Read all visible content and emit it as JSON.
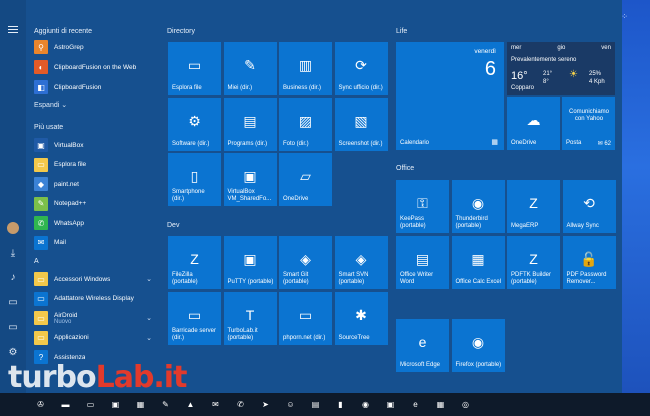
{
  "rail": {
    "hamburger": "menu-icon"
  },
  "recent": {
    "header": "Aggiunti di recente",
    "items": [
      {
        "label": "AstroGrep",
        "color": "#e9852c",
        "icon": "⚲"
      },
      {
        "label": "ClipboardFusion on the Web",
        "color": "#e25b28",
        "icon": "◐"
      },
      {
        "label": "ClipboardFusion",
        "color": "#2d6fd4",
        "icon": "◧"
      }
    ],
    "expand": "Espandi ⌄"
  },
  "most_used": {
    "header": "Più usate",
    "items": [
      {
        "label": "VirtualBox",
        "color": "#1f5aa6",
        "icon": "▣"
      },
      {
        "label": "Esplora file",
        "color": "#f2c84b",
        "icon": "▭"
      },
      {
        "label": "paint.net",
        "color": "#3b82d6",
        "icon": "◆"
      },
      {
        "label": "Notepad++",
        "color": "#7bbf4a",
        "icon": "✎"
      },
      {
        "label": "WhatsApp",
        "color": "#2fb650",
        "icon": "✆"
      },
      {
        "label": "Mail",
        "color": "#0b74d1",
        "icon": "✉"
      }
    ]
  },
  "alpha": {
    "header": "A",
    "items": [
      {
        "label": "Accessori Windows",
        "sub": "",
        "color": "#f2c84b",
        "icon": "▭",
        "chev": "⌄"
      },
      {
        "label": "Adattatore Wireless Display",
        "sub": "",
        "color": "#0b74d1",
        "icon": "▭",
        "chev": ""
      },
      {
        "label": "AirDroid",
        "sub": "Nuovo",
        "color": "#f2c84b",
        "icon": "▭",
        "chev": "⌄"
      },
      {
        "label": "Applicazioni",
        "sub": "",
        "color": "#f2c84b",
        "icon": "▭",
        "chev": "⌄"
      },
      {
        "label": "Assistenza",
        "sub": "",
        "color": "#0b74d1",
        "icon": "?",
        "chev": ""
      }
    ]
  },
  "groups": {
    "directory": {
      "header": "Directory",
      "tiles": [
        {
          "label": "Esplora file",
          "icon": "▭"
        },
        {
          "label": "Miei (dir.)",
          "icon": "✎"
        },
        {
          "label": "Business (dir.)",
          "icon": "▥"
        },
        {
          "label": "Sync ufficio (dir.)",
          "icon": "⟳"
        },
        {
          "label": "Software (dir.)",
          "icon": "⚙"
        },
        {
          "label": "Programs (dir.)",
          "icon": "▤"
        },
        {
          "label": "Foto (dir.)",
          "icon": "▨"
        },
        {
          "label": "Screenshot (dir.)",
          "icon": "▧"
        },
        {
          "label": "Smartphone (dir.)",
          "icon": "▯"
        },
        {
          "label": "VirtualBox VM_SharedFo...",
          "icon": "▣"
        },
        {
          "label": "OneDrive",
          "icon": "▱"
        }
      ]
    },
    "dev": {
      "header": "Dev",
      "tiles": [
        {
          "label": "FileZilla (portable)",
          "icon": "Z"
        },
        {
          "label": "PuTTY (portable)",
          "icon": "▣"
        },
        {
          "label": "Smart Git (portable)",
          "icon": "◈"
        },
        {
          "label": "Smart SVN (portable)",
          "icon": "◈"
        },
        {
          "label": "Barricade server (dir.)",
          "icon": "▭"
        },
        {
          "label": "TurboLab.it (portable)",
          "icon": "T"
        },
        {
          "label": "phporn.net (dir.)",
          "icon": "▭"
        },
        {
          "label": "SourceTree",
          "icon": "✱"
        }
      ]
    },
    "life": {
      "header": "Life",
      "calendar": {
        "day": "venerdì",
        "num": "6",
        "label": "Calendario"
      },
      "weather": {
        "days": [
          "mer",
          "gio",
          "ven"
        ],
        "condition": "Prevalentemente sereno",
        "temp": "16°",
        "city": "Copparo",
        "hi": "21°",
        "lo": "8°",
        "humidity": "25%",
        "wind": "4 Kph"
      },
      "onedrive": "OneDrive",
      "yahoo": "Comunichiamo con Yahoo",
      "posta": "Posta",
      "posta_count": "62"
    },
    "office": {
      "header": "Office",
      "tiles": [
        {
          "label": "KeePass (portable)",
          "icon": "⚿"
        },
        {
          "label": "Thunderbird (portable)",
          "icon": "◉"
        },
        {
          "label": "MegaERP",
          "icon": "Z"
        },
        {
          "label": "Allway Sync",
          "icon": "⟲"
        },
        {
          "label": "Office Writer Word",
          "icon": "▤"
        },
        {
          "label": "Office Calc Excel",
          "icon": "▦"
        },
        {
          "label": "PDFTK Builder (portable)",
          "icon": "Z"
        },
        {
          "label": "PDF Password Remover...",
          "icon": "🔓"
        },
        {
          "label": "Microsoft Edge",
          "icon": "e"
        },
        {
          "label": "Firefox (portable)",
          "icon": "◉"
        }
      ]
    }
  },
  "taskbar": {
    "icons": [
      "start-icon",
      "terminal-icon",
      "folder-icon",
      "virtualbox-icon",
      "box-icon",
      "notepad-icon",
      "vlc-icon",
      "mail-icon",
      "whatsapp-icon",
      "telegram-icon",
      "user-icon",
      "calendar-icon",
      "sticky-icon",
      "chrome-icon",
      "store-icon",
      "edge-icon",
      "calculator-icon",
      "power-icon"
    ],
    "glyphs": [
      "✇",
      "▬",
      "▭",
      "▣",
      "▦",
      "✎",
      "▲",
      "✉",
      "✆",
      "➤",
      "☺",
      "▤",
      "▮",
      "◉",
      "▣",
      "e",
      "▦",
      "◎"
    ]
  },
  "watermark": {
    "a": "turbo",
    "b": "Lab.it"
  }
}
